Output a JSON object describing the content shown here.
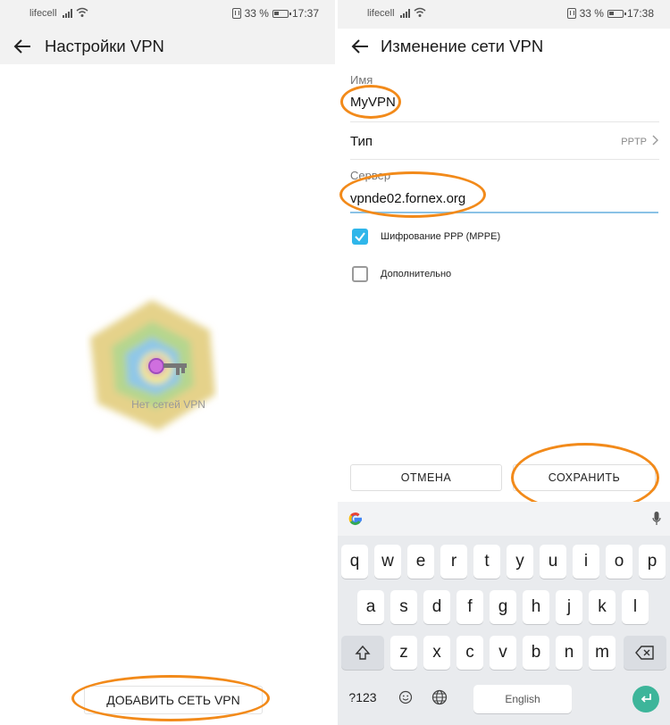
{
  "left": {
    "status": {
      "carrier": "lifecell",
      "battery": "33 %",
      "time": "17:37"
    },
    "title": "Настройки VPN",
    "empty_text": "Нет сетей VPN",
    "add_button": "ДОБАВИТЬ СЕТЬ VPN"
  },
  "right": {
    "status": {
      "carrier": "lifecell",
      "battery": "33 %",
      "time": "17:38"
    },
    "title": "Изменение сети VPN",
    "name_label": "Имя",
    "name_value": "MyVPN",
    "type_label": "Тип",
    "type_value": "PPTP",
    "server_label": "Сервер",
    "server_value": "vpnde02.fornex.org",
    "encryption_label": "Шифрование PPP (MPPE)",
    "encryption_checked": true,
    "advanced_label": "Дополнительно",
    "advanced_checked": false,
    "cancel_button": "ОТМЕНА",
    "save_button": "СОХРАНИТЬ"
  },
  "keyboard": {
    "row1": [
      "q",
      "w",
      "e",
      "r",
      "t",
      "y",
      "u",
      "i",
      "o",
      "p"
    ],
    "row2": [
      "a",
      "s",
      "d",
      "f",
      "g",
      "h",
      "j",
      "k",
      "l"
    ],
    "row3": [
      "z",
      "x",
      "c",
      "v",
      "b",
      "n",
      "m"
    ],
    "symbols_key": "?123",
    "space_label": "English"
  },
  "colors": {
    "accent": "#2fb6ea",
    "highlight": "#f28a1a",
    "enter": "#3db59a"
  }
}
